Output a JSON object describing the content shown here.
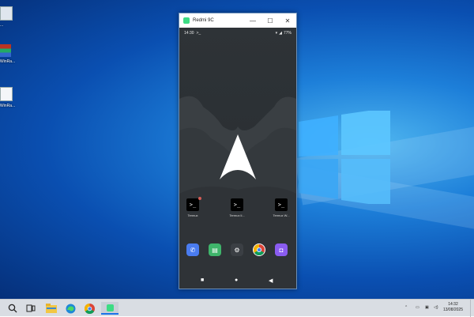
{
  "desktop": {
    "icons": [
      {
        "label": "..."
      },
      {
        "label": "WinRa..."
      },
      {
        "label": "WinRa..."
      }
    ]
  },
  "window": {
    "title": "Redmi 9C",
    "controls": {
      "minimize": "—",
      "maximize": "☐",
      "close": "✕"
    }
  },
  "phone": {
    "status": {
      "time": "14:30",
      "notif": ">_",
      "battery": "77%"
    },
    "apps": [
      {
        "label": "Termux"
      },
      {
        "label": "Termux li..."
      },
      {
        "label": "Termux W..."
      }
    ],
    "dock": [
      {
        "icon": "phone-icon",
        "color": "#4a7cf0"
      },
      {
        "icon": "messages-icon",
        "color": "#3fb56b"
      },
      {
        "icon": "settings-icon",
        "color": "#3b3f44"
      },
      {
        "icon": "chrome-icon",
        "color": "#ffffff"
      },
      {
        "icon": "camera-icon",
        "color": "#8a5cf0"
      }
    ],
    "nav": {
      "recents": "■",
      "home": "●",
      "back": "◀"
    }
  },
  "taskbar": {
    "clock_time": "14:32",
    "clock_date": "13/08/2025"
  }
}
